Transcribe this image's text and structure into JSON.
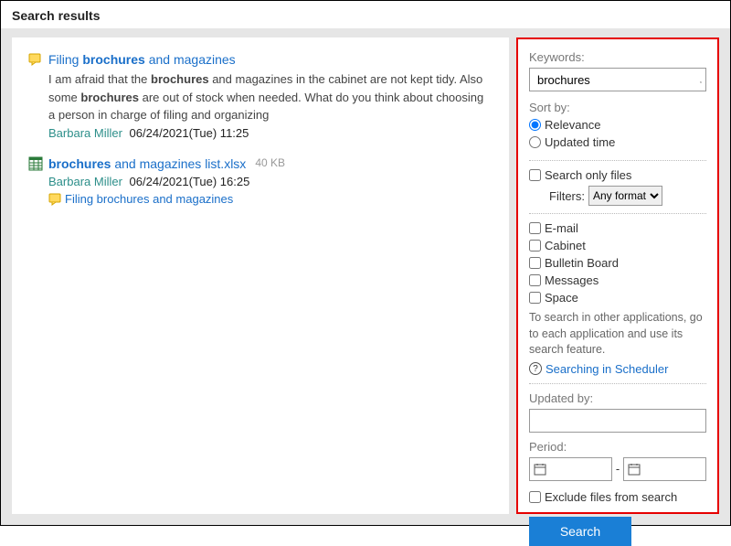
{
  "page_title": "Search results",
  "results": [
    {
      "title_pre": "Filing ",
      "title_kw": "brochures",
      "title_post": " and magazines",
      "snippet_pre": "I am afraid that the  ",
      "snippet_kw1": "brochures",
      "snippet_mid": "  and magazines in the cabinet are not kept tidy. Also some  ",
      "snippet_kw2": "brochures",
      "snippet_post": "  are out of stock when needed. What do you think about choosing a person in charge of filing and organizing",
      "author": "Barbara Miller",
      "timestamp": "06/24/2021(Tue) 11:25"
    },
    {
      "title_kw": "brochures",
      "title_post": " and magazines list.xlsx",
      "file_size": "40 KB",
      "author": "Barbara Miller",
      "timestamp": "06/24/2021(Tue) 16:25",
      "linked_thread": "Filing brochures and magazines"
    }
  ],
  "filters": {
    "keywords_label": "Keywords:",
    "keywords_value": "brochures",
    "sort_label": "Sort by:",
    "sort_relevance": "Relevance",
    "sort_updated": "Updated time",
    "search_only_files": "Search only files",
    "filters_label": "Filters:",
    "filters_select": "Any format",
    "apps": [
      "E-mail",
      "Cabinet",
      "Bulletin Board",
      "Messages",
      "Space"
    ],
    "help_text": "To search in other applications, go to each application and use its search feature.",
    "help_link": "Searching in Scheduler",
    "updated_by_label": "Updated by:",
    "period_label": "Period:",
    "exclude_files": "Exclude files from search",
    "search_button": "Search"
  }
}
